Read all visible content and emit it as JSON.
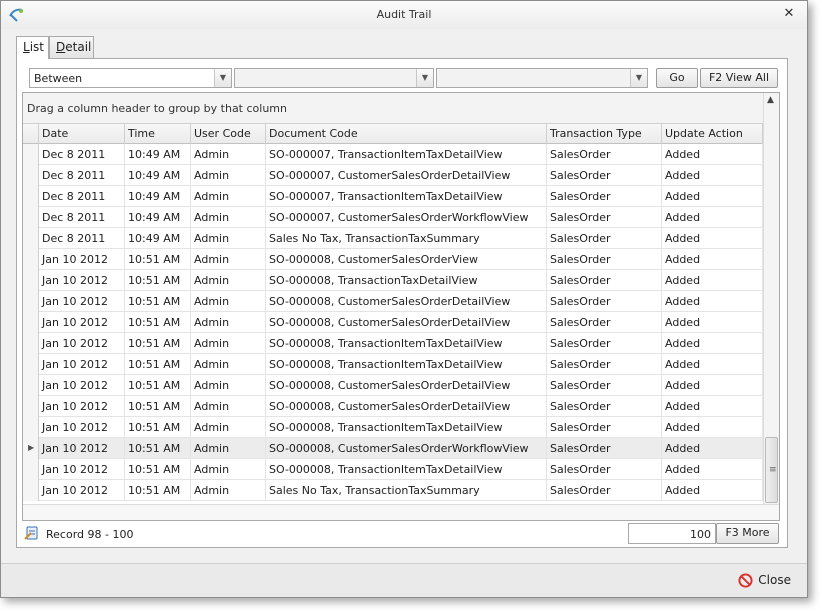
{
  "window": {
    "title": "Audit Trail"
  },
  "tabs": [
    {
      "pre": "",
      "underline": "L",
      "post": "ist"
    },
    {
      "pre": "",
      "underline": "D",
      "post": "etail"
    }
  ],
  "filter": {
    "operator": "Between",
    "from": "",
    "to": ""
  },
  "buttons": {
    "go": "Go",
    "view_all": "F2 View All",
    "more": "F3 More",
    "close": "Close"
  },
  "grid": {
    "group_hint": "Drag a column header to group by that column",
    "columns": [
      "Date",
      "Time",
      "User Code",
      "Document Code",
      "Transaction Type",
      "Update Action"
    ],
    "rows": [
      [
        "Dec 8 2011",
        "10:49 AM",
        "Admin",
        "SO-000007, TransactionItemTaxDetailView",
        "SalesOrder",
        "Added"
      ],
      [
        "Dec 8 2011",
        "10:49 AM",
        "Admin",
        "SO-000007, CustomerSalesOrderDetailView",
        "SalesOrder",
        "Added"
      ],
      [
        "Dec 8 2011",
        "10:49 AM",
        "Admin",
        "SO-000007, TransactionItemTaxDetailView",
        "SalesOrder",
        "Added"
      ],
      [
        "Dec 8 2011",
        "10:49 AM",
        "Admin",
        "SO-000007, CustomerSalesOrderWorkflowView",
        "SalesOrder",
        "Added"
      ],
      [
        "Dec 8 2011",
        "10:49 AM",
        "Admin",
        "Sales No Tax, TransactionTaxSummary",
        "SalesOrder",
        "Added"
      ],
      [
        "Jan 10 2012",
        "10:51 AM",
        "Admin",
        "SO-000008, CustomerSalesOrderView",
        "SalesOrder",
        "Added"
      ],
      [
        "Jan 10 2012",
        "10:51 AM",
        "Admin",
        "SO-000008, TransactionTaxDetailView",
        "SalesOrder",
        "Added"
      ],
      [
        "Jan 10 2012",
        "10:51 AM",
        "Admin",
        "SO-000008, CustomerSalesOrderDetailView",
        "SalesOrder",
        "Added"
      ],
      [
        "Jan 10 2012",
        "10:51 AM",
        "Admin",
        "SO-000008, CustomerSalesOrderDetailView",
        "SalesOrder",
        "Added"
      ],
      [
        "Jan 10 2012",
        "10:51 AM",
        "Admin",
        "SO-000008, TransactionItemTaxDetailView",
        "SalesOrder",
        "Added"
      ],
      [
        "Jan 10 2012",
        "10:51 AM",
        "Admin",
        "SO-000008, TransactionItemTaxDetailView",
        "SalesOrder",
        "Added"
      ],
      [
        "Jan 10 2012",
        "10:51 AM",
        "Admin",
        "SO-000008, CustomerSalesOrderDetailView",
        "SalesOrder",
        "Added"
      ],
      [
        "Jan 10 2012",
        "10:51 AM",
        "Admin",
        "SO-000008, CustomerSalesOrderDetailView",
        "SalesOrder",
        "Added"
      ],
      [
        "Jan 10 2012",
        "10:51 AM",
        "Admin",
        "SO-000008, TransactionItemTaxDetailView",
        "SalesOrder",
        "Added"
      ],
      [
        "Jan 10 2012",
        "10:51 AM",
        "Admin",
        "SO-000008, CustomerSalesOrderWorkflowView",
        "SalesOrder",
        "Added"
      ],
      [
        "Jan 10 2012",
        "10:51 AM",
        "Admin",
        "SO-000008, TransactionItemTaxDetailView",
        "SalesOrder",
        "Added"
      ],
      [
        "Jan 10 2012",
        "10:51 AM",
        "Admin",
        "Sales No Tax, TransactionTaxSummary",
        "SalesOrder",
        "Added"
      ]
    ],
    "current_row": 14
  },
  "status": {
    "record_text": "Record 98 - 100",
    "count": "100"
  },
  "icons": {
    "app": "app-logo-icon",
    "close": "close-icon",
    "dropdown": "chevron-down-icon",
    "scroll_up": "scroll-up-icon",
    "record": "record-count-icon",
    "close_button": "no-entry-icon"
  },
  "colors": {
    "close_icon": "#d9302c",
    "app_icon": "#3a86c8"
  }
}
